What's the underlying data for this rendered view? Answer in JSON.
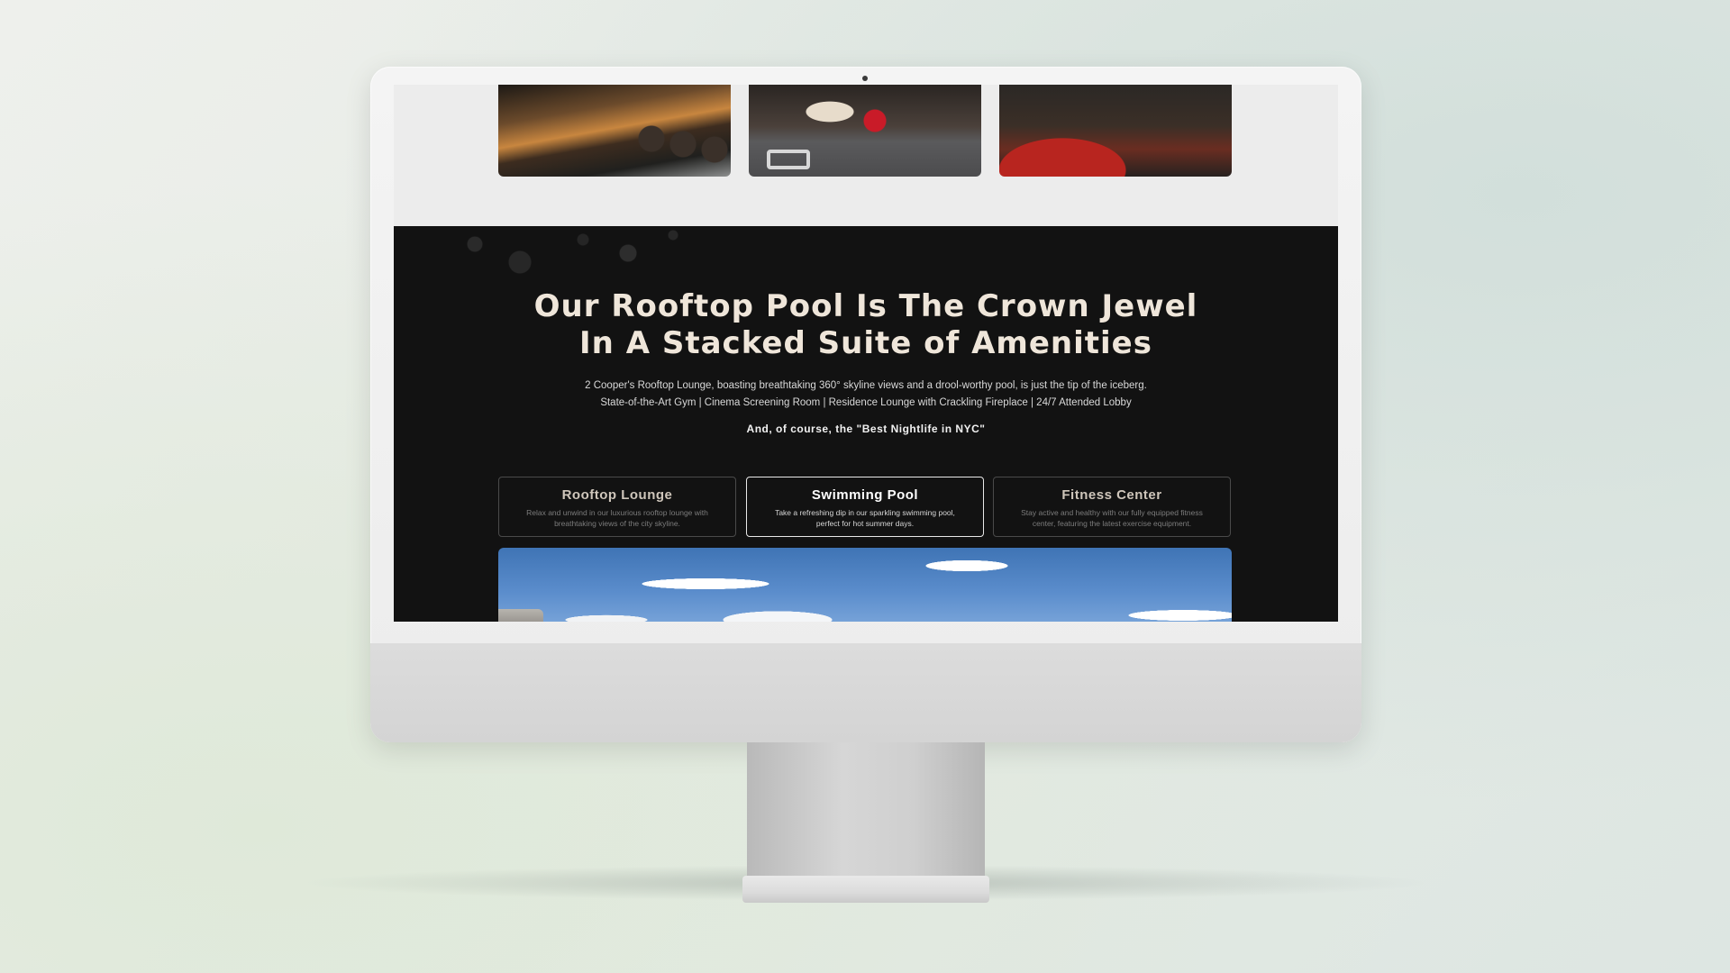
{
  "section": {
    "headline_line1": "Our Rooftop Pool Is The Crown Jewel",
    "headline_line2": "In A Stacked Suite of Amenities",
    "intro_line1": "2 Cooper's Rooftop Lounge, boasting breathtaking 360° skyline views and a drool-worthy pool, is just the tip of the iceberg.",
    "intro_line2": "State-of-the-Art Gym | Cinema Screening Room | Residence Lounge with Crackling Fireplace | 24/7 Attended Lobby",
    "nightlife": "And, of course, the \"Best Nightlife in NYC\""
  },
  "tabs": [
    {
      "title": "Rooftop Lounge",
      "description": "Relax and unwind in our luxurious rooftop lounge with breathtaking views of the city skyline.",
      "active": false
    },
    {
      "title": "Swimming Pool",
      "description": "Take a refreshing dip in our sparkling swimming pool, perfect for hot summer days.",
      "active": true
    },
    {
      "title": "Fitness Center",
      "description": "Stay active and healthy with our fully equipped fitness center, featuring the latest exercise equipment.",
      "active": false
    }
  ],
  "colors": {
    "dark_section": "#121212",
    "headline": "#efe6da",
    "active_border": "#e8e8e8",
    "inactive_border": "#4a4a4a"
  }
}
